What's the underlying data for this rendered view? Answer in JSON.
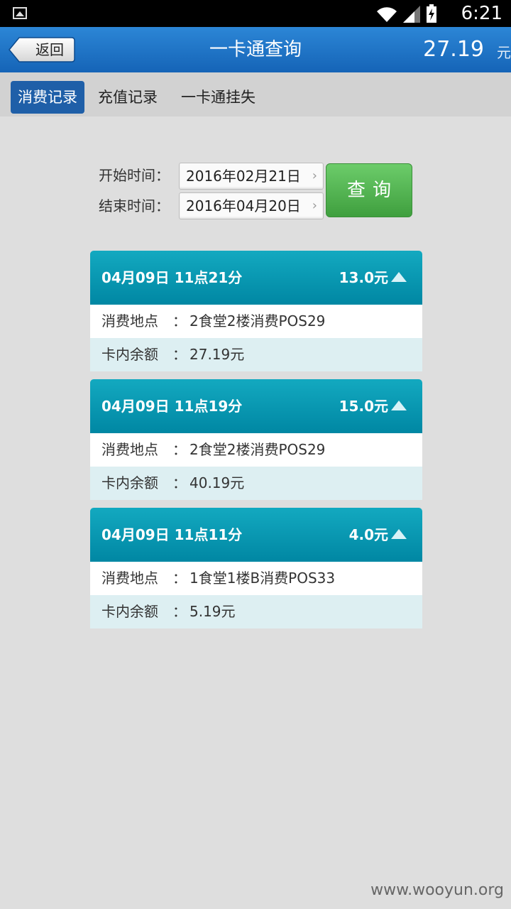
{
  "status": {
    "time": "6:21"
  },
  "header": {
    "back_label": "返回",
    "title": "一卡通查询",
    "balance": "27.19",
    "balance_unit": "元"
  },
  "tabs": [
    {
      "label": "消费记录",
      "active": true
    },
    {
      "label": "充值记录",
      "active": false
    },
    {
      "label": "一卡通挂失",
      "active": false
    }
  ],
  "filter": {
    "start_label": "开始时间：",
    "start_value": "2016年02月21日",
    "end_label": "结束时间：",
    "end_value": "2016年04月20日",
    "query_label": "查询"
  },
  "records": [
    {
      "datetime": "04月09日 11点21分",
      "amount": "13.0元",
      "location_label": "消费地点",
      "location": "2食堂2楼消费POS29",
      "balance_label": "卡内余额",
      "balance": "27.19元"
    },
    {
      "datetime": "04月09日 11点19分",
      "amount": "15.0元",
      "location_label": "消费地点",
      "location": "2食堂2楼消费POS29",
      "balance_label": "卡内余额",
      "balance": "40.19元"
    },
    {
      "datetime": "04月09日 11点11分",
      "amount": "4.0元",
      "location_label": "消费地点",
      "location": "1食堂1楼B消费POS33",
      "balance_label": "卡内余额",
      "balance": "5.19元"
    }
  ],
  "colon": "：",
  "watermark": "www.wooyun.org",
  "colors": {
    "titlebar": "#1f73c6",
    "tab_active": "#1f5fa8",
    "card_header": "#0d9cb5",
    "query_button": "#52b451"
  }
}
